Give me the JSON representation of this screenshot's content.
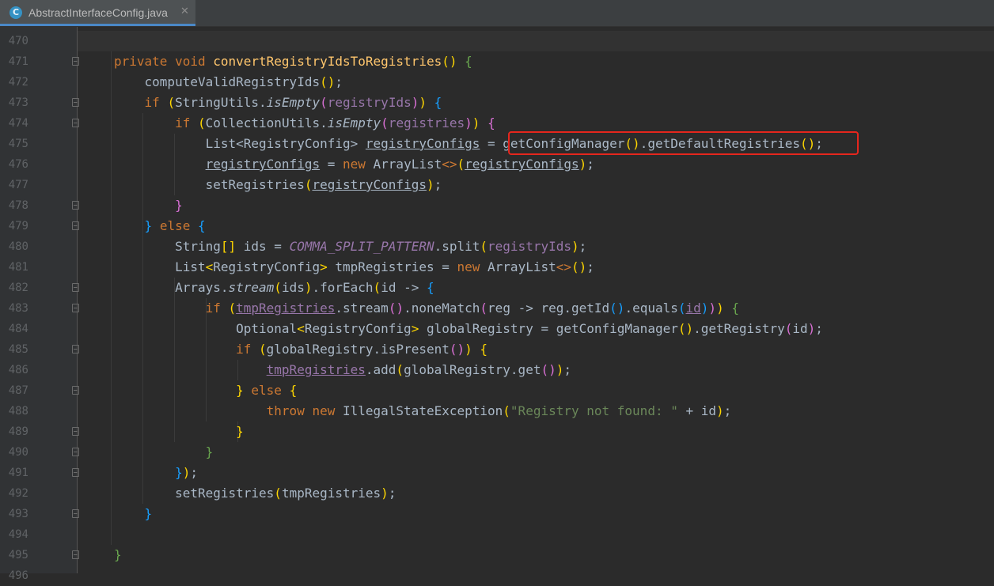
{
  "tab": {
    "title": "AbstractInterfaceConfig.java",
    "icon": "java-class-icon",
    "icon_letter": "C"
  },
  "lines": [
    {
      "n": "470",
      "html": ""
    },
    {
      "n": "471",
      "html": "<span class=\"kw\">private void </span><span class=\"fn\">convertRegistryIdsToRegistries</span><span class=\"b1\">()</span> <span class=\"b4\">{</span>"
    },
    {
      "n": "472",
      "html": "    computeValidRegistryIds<span class=\"b1\">()</span>;"
    },
    {
      "n": "473",
      "html": "    <span class=\"kw\">if </span><span class=\"b1\">(</span>StringUtils.<span class=\"it\">isEmpty</span><span class=\"b2\">(</span><span class=\"fld\">registryIds</span><span class=\"b2\">)</span><span class=\"b1\">)</span> <span class=\"b3\">{</span>"
    },
    {
      "n": "474",
      "html": "        <span class=\"kw\">if </span><span class=\"b1\">(</span>CollectionUtils.<span class=\"it\">isEmpty</span><span class=\"b2\">(</span><span class=\"fld\">registries</span><span class=\"b2\">)</span><span class=\"b1\">)</span> <span class=\"b2\">{</span>"
    },
    {
      "n": "475",
      "html": "            List&lt;RegistryConfig&gt; <span class=\"ul\">registryConfigs</span> = getConfigManager<span class=\"b1\">()</span>.getDefaultRegistries<span class=\"b1\">()</span>;"
    },
    {
      "n": "476",
      "html": "            <span class=\"ul\">registryConfigs</span> = <span class=\"kw\">new </span>ArrayList<span class=\"kw\">&lt;&gt;</span><span class=\"b1\">(</span><span class=\"ul\">registryConfigs</span><span class=\"b1\">)</span>;"
    },
    {
      "n": "477",
      "html": "            setRegistries<span class=\"b1\">(</span><span class=\"ul\">registryConfigs</span><span class=\"b1\">)</span>;"
    },
    {
      "n": "478",
      "html": "        <span class=\"b2\">}</span>"
    },
    {
      "n": "479",
      "html": "    <span class=\"b3\">}</span> <span class=\"kw\">else </span><span class=\"b3\">{</span>"
    },
    {
      "n": "480",
      "html": "        String<span class=\"b1\">[]</span> ids = <span class=\"cst\">COMMA_SPLIT_PATTERN</span>.split<span class=\"b1\">(</span><span class=\"fld\">registryIds</span><span class=\"b1\">)</span>;"
    },
    {
      "n": "481",
      "html": "        List<span class=\"b1\">&lt;</span>RegistryConfig<span class=\"b1\">&gt;</span> tmpRegistries = <span class=\"kw\">new </span>ArrayList<span class=\"kw\">&lt;&gt;</span><span class=\"b1\">()</span>;"
    },
    {
      "n": "482",
      "html": "        Arrays.<span class=\"it\">stream</span><span class=\"b1\">(</span>ids<span class=\"b1\">)</span>.forEach<span class=\"b1\">(</span>id -&gt; <span class=\"b3\">{</span>"
    },
    {
      "n": "483",
      "html": "            <span class=\"kw\">if </span><span class=\"b1\">(</span><span class=\"fld ulp\">tmpRegistries</span>.stream<span class=\"b2\">()</span>.noneMatch<span class=\"b2\">(</span>reg -&gt; reg.getId<span class=\"b3\">()</span>.equals<span class=\"b3\">(</span><span class=\"fld ulp\">id</span><span class=\"b3\">)</span><span class=\"b2\">)</span><span class=\"b1\">)</span> <span class=\"b4\">{</span>"
    },
    {
      "n": "484",
      "html": "                Optional<span class=\"b1\">&lt;</span>RegistryConfig<span class=\"b1\">&gt;</span> globalRegistry = getConfigManager<span class=\"b1\">()</span>.getRegistry<span class=\"b2\">(</span>id<span class=\"b2\">)</span>;"
    },
    {
      "n": "485",
      "html": "                <span class=\"kw\">if </span><span class=\"b1\">(</span>globalRegistry.isPresent<span class=\"b2\">()</span><span class=\"b1\">)</span> <span class=\"b1\">{</span>"
    },
    {
      "n": "486",
      "html": "                    <span class=\"fld ulp\">tmpRegistries</span>.add<span class=\"b1\">(</span>globalRegistry.get<span class=\"b2\">()</span><span class=\"b1\">)</span>;"
    },
    {
      "n": "487",
      "html": "                <span class=\"b1\">}</span> <span class=\"kw\">else </span><span class=\"b1\">{</span>"
    },
    {
      "n": "488",
      "html": "                    <span class=\"kw\">throw new </span>IllegalStateException<span class=\"b1\">(</span><span class=\"str\">\"Registry not found: \"</span> + id<span class=\"b1\">)</span>;"
    },
    {
      "n": "489",
      "html": "                <span class=\"b1\">}</span>"
    },
    {
      "n": "490",
      "html": "            <span class=\"b4\">}</span>"
    },
    {
      "n": "491",
      "html": "        <span class=\"b3\">}</span><span class=\"b1\">)</span>;"
    },
    {
      "n": "492",
      "html": "        setRegistries<span class=\"b1\">(</span>tmpRegistries<span class=\"b1\">)</span>;"
    },
    {
      "n": "493",
      "html": "    <span class=\"b3\">}</span>"
    },
    {
      "n": "494",
      "html": ""
    },
    {
      "n": "495",
      "html": "<span class=\"b4\">}</span>"
    },
    {
      "n": "496",
      "html": ""
    }
  ],
  "fold_lines": [
    "471",
    "473",
    "474",
    "478",
    "479",
    "482",
    "483",
    "485",
    "487",
    "489",
    "490",
    "491",
    "493",
    "495"
  ],
  "highlight": {
    "line": "475",
    "text": "getConfigManager().getDefaultRegistries();",
    "color": "#e5261d"
  }
}
